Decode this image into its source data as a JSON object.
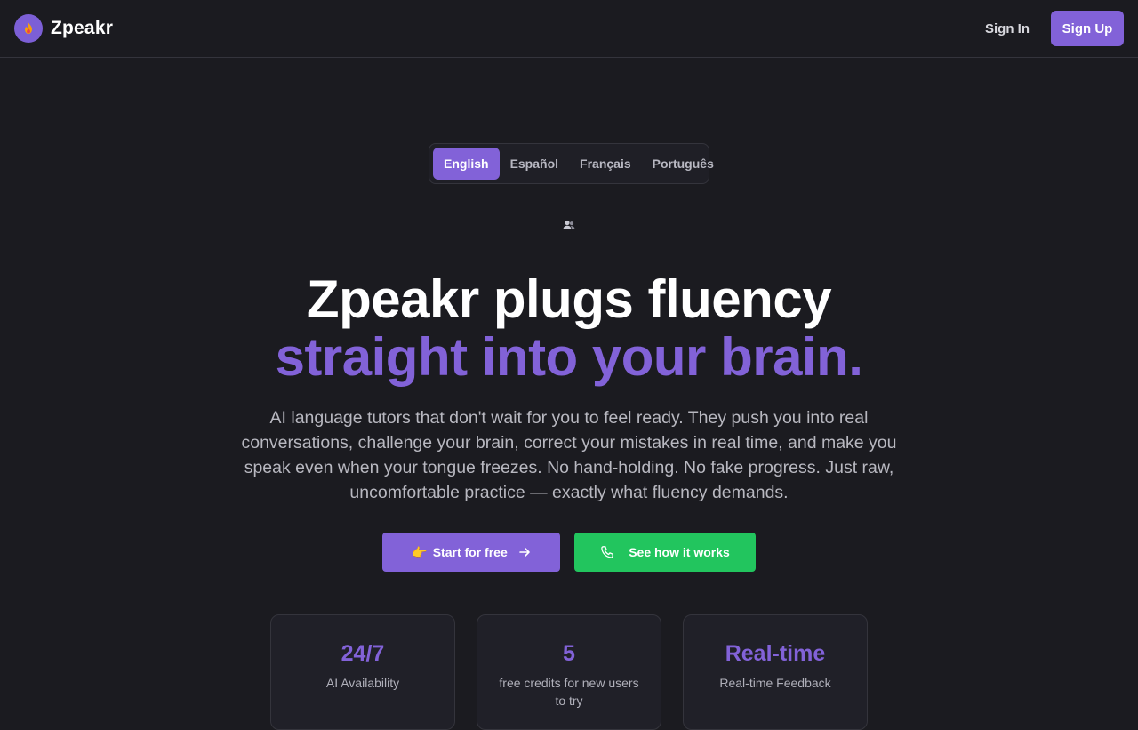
{
  "header": {
    "brand": "Zpeakr",
    "sign_in": "Sign In",
    "sign_up": "Sign Up"
  },
  "languages": {
    "tabs": [
      "English",
      "Español",
      "Français",
      "Português"
    ],
    "selected": "English"
  },
  "hero": {
    "headline_line1": "Zpeakr plugs fluency",
    "headline_line2": "straight into your brain.",
    "subtitle": "AI language tutors that don't wait for you to feel ready. They push you into real conversations, challenge your brain, correct your mistakes in real time, and make you speak even when your tongue freezes. No hand-holding. No fake progress. Just raw, uncomfortable practice — exactly what fluency demands.",
    "primary_cta": "Start for free",
    "primary_cta_emoji": "👉",
    "secondary_cta": "See how it works"
  },
  "stats": [
    {
      "value": "24/7",
      "label": "AI Availability"
    },
    {
      "value": "5",
      "label": "free credits for new users to try"
    },
    {
      "value": "Real-time",
      "label": "Real-time Feedback"
    }
  ],
  "icons": {
    "logo": "flame-icon",
    "users": "users-icon",
    "arrow": "arrow-right-icon",
    "phone": "phone-icon"
  },
  "colors": {
    "background": "#1b1b20",
    "accent": "#8262d8",
    "success": "#22c55e",
    "text_muted": "#b8b8c0"
  }
}
